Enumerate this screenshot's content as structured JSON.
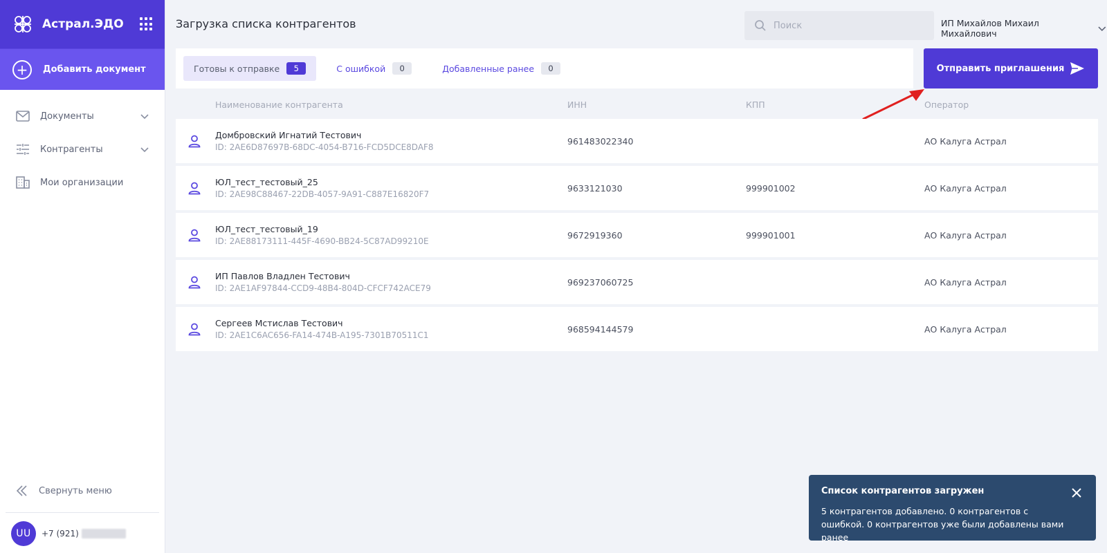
{
  "app": {
    "name": "Астрал.ЭДО",
    "add_document": "Добавить документ"
  },
  "sidebar": {
    "items": [
      {
        "label": "Документы",
        "icon": "mail-icon",
        "expandable": true
      },
      {
        "label": "Контрагенты",
        "icon": "sliders-icon",
        "expandable": true
      },
      {
        "label": "Мои организации",
        "icon": "building-icon",
        "expandable": false
      }
    ],
    "collapse_label": "Свернуть меню",
    "user": {
      "initials": "UU",
      "phone": "+7 (921)"
    }
  },
  "header": {
    "title": "Загрузка списка контрагентов",
    "search_placeholder": "Поиск",
    "profile_name": "ИП Михайлов Михаил Михайлович"
  },
  "tabs": [
    {
      "label": "Готовы к отправке",
      "count": "5",
      "active": true
    },
    {
      "label": "С ошибкой",
      "count": "0",
      "active": false
    },
    {
      "label": "Добавленные ранее",
      "count": "0",
      "active": false
    }
  ],
  "send_button": "Отправить приглашения",
  "table": {
    "columns": [
      "Наименование контрагента",
      "ИНН",
      "КПП",
      "Оператор"
    ],
    "rows": [
      {
        "name": "Домбровский Игнатий Тестович",
        "id": "ID: 2AE6D87697B-68DC-4054-B716-FCD5DCE8DAF8",
        "inn": "961483022340",
        "kpp": "",
        "operator": "АО Калуга Астрал"
      },
      {
        "name": "ЮЛ_тест_тестовый_25",
        "id": "ID: 2AE98C88467-22DB-4057-9A91-C887E16820F7",
        "inn": "9633121030",
        "kpp": "999901002",
        "operator": "АО Калуга Астрал"
      },
      {
        "name": "ЮЛ_тест_тестовый_19",
        "id": "ID: 2AE88173111-445F-4690-BB24-5C87AD99210E",
        "inn": "9672919360",
        "kpp": "999901001",
        "operator": "АО Калуга Астрал"
      },
      {
        "name": "ИП Павлов Владлен Тестович",
        "id": "ID: 2AE1AF97844-CCD9-48B4-804D-CFCF742ACE79",
        "inn": "969237060725",
        "kpp": "",
        "operator": "АО Калуга Астрал"
      },
      {
        "name": "Сергеев Мстислав Тестович",
        "id": "ID: 2AE1C6AC656-FA14-474B-A195-7301B70511C1",
        "inn": "968594144579",
        "kpp": "",
        "operator": "АО Калуга Астрал"
      }
    ]
  },
  "toast": {
    "title": "Список контрагентов загружен",
    "message": "5 контрагентов добавлено. 0 контрагентов с ошибкой. 0 контрагентов уже были добавлены вами ранее"
  },
  "colors": {
    "brand": "#4f3ad6",
    "brand_light": "#6a55ee",
    "toast_bg": "#2c4a6e",
    "annotation_arrow": "#e0201f"
  }
}
